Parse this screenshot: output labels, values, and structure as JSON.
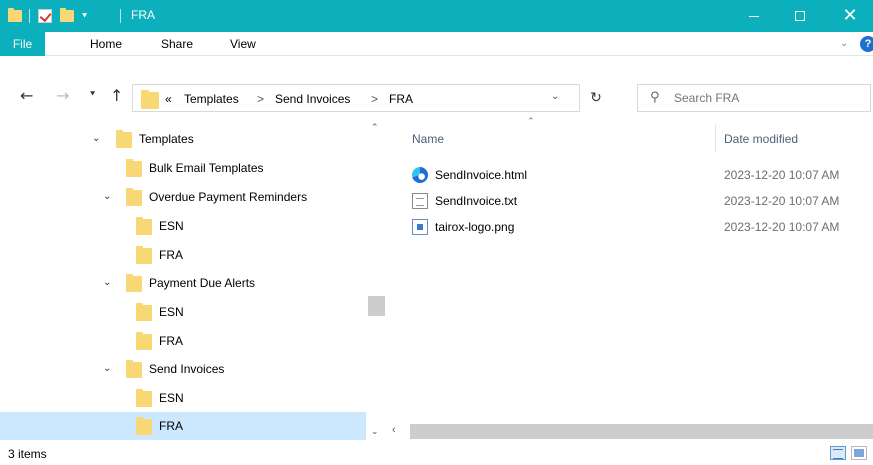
{
  "window": {
    "title": "FRA",
    "accent_color": "#0cb0bd",
    "minimize_icon": "minimize-icon",
    "maximize_icon": "maximize-icon",
    "close_icon": "close-icon",
    "close_glyph": "✕"
  },
  "ribbon": {
    "tabs": [
      "File",
      "Home",
      "Share",
      "View"
    ]
  },
  "address": {
    "overflow": "«",
    "separator": ">",
    "crumbs": [
      "Templates",
      "Send Invoices",
      "FRA"
    ]
  },
  "search": {
    "placeholder": "Search FRA"
  },
  "nav_pane": {
    "items": [
      {
        "label": "Templates",
        "expanded": true,
        "selected": false
      },
      {
        "label": "Bulk Email Templates",
        "expanded": false,
        "selected": false
      },
      {
        "label": "Overdue Payment Reminders",
        "expanded": true,
        "selected": false
      },
      {
        "label": "ESN",
        "expanded": false,
        "selected": false
      },
      {
        "label": "FRA",
        "expanded": false,
        "selected": false
      },
      {
        "label": "Payment Due Alerts",
        "expanded": true,
        "selected": false
      },
      {
        "label": "ESN",
        "expanded": false,
        "selected": false
      },
      {
        "label": "FRA",
        "expanded": false,
        "selected": false
      },
      {
        "label": "Send Invoices",
        "expanded": true,
        "selected": false
      },
      {
        "label": "ESN",
        "expanded": false,
        "selected": false
      },
      {
        "label": "FRA",
        "expanded": false,
        "selected": true
      }
    ],
    "selection_color": "#cce8ff"
  },
  "file_list": {
    "columns": [
      "Name",
      "Date modified"
    ],
    "files": [
      {
        "name": "SendInvoice.html",
        "date_modified": "2023-12-20 10:07 AM",
        "icon": "edge-html-icon"
      },
      {
        "name": "SendInvoice.txt",
        "date_modified": "2023-12-20 10:07 AM",
        "icon": "text-file-icon"
      },
      {
        "name": "tairox-logo.png",
        "date_modified": "2023-12-20 10:07 AM",
        "icon": "png-file-icon"
      }
    ]
  },
  "status": {
    "item_count": "3 items"
  }
}
